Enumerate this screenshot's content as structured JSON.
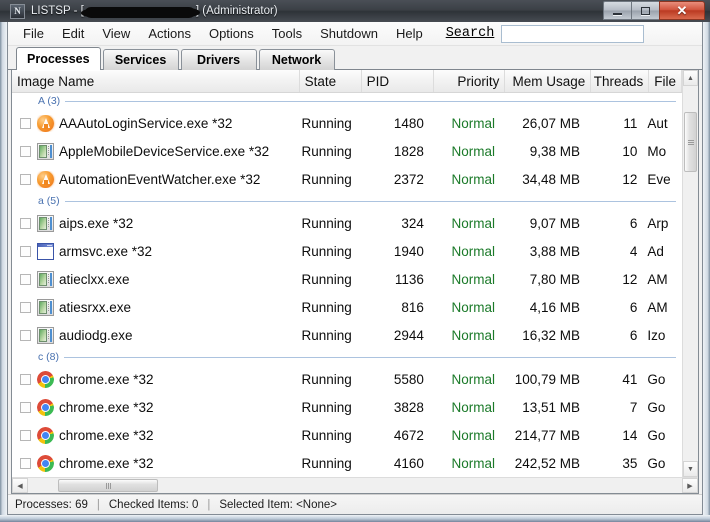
{
  "window": {
    "app_icon_glyph": "N",
    "title_prefix": "LISTSP - [",
    "title_suffix": "] (Administrator)",
    "controls": {
      "minimize": "–",
      "maximize": "□",
      "close": "✕"
    }
  },
  "menubar": {
    "items": [
      {
        "label": "File"
      },
      {
        "label": "Edit"
      },
      {
        "label": "View"
      },
      {
        "label": "Actions"
      },
      {
        "label": "Options"
      },
      {
        "label": "Tools"
      },
      {
        "label": "Shutdown"
      },
      {
        "label": "Help"
      }
    ],
    "search_label": "Search",
    "search_value": "",
    "search_placeholder": ""
  },
  "tabs": [
    {
      "label": "Processes",
      "active": true
    },
    {
      "label": "Services",
      "active": false
    },
    {
      "label": "Drivers",
      "active": false
    },
    {
      "label": "Network",
      "active": false
    }
  ],
  "columns": [
    {
      "key": "name",
      "label": "Image Name",
      "align": "left"
    },
    {
      "key": "state",
      "label": "State",
      "align": "left"
    },
    {
      "key": "pid",
      "label": "PID",
      "align": "left"
    },
    {
      "key": "priority",
      "label": "Priority",
      "align": "right"
    },
    {
      "key": "mem",
      "label": "Mem Usage",
      "align": "right"
    },
    {
      "key": "threads",
      "label": "Threads",
      "align": "right"
    },
    {
      "key": "file",
      "label": "File",
      "align": "left"
    }
  ],
  "groups": [
    {
      "label": "A (3)",
      "rows": [
        {
          "checked": false,
          "icon": "autoit-icon",
          "name": "AAAutoLoginService.exe *32",
          "state": "Running",
          "pid": "1480",
          "priority": "Normal",
          "mem": "26,07 MB",
          "threads": "11",
          "file": "Aut"
        },
        {
          "checked": false,
          "icon": "app-window-icon",
          "name": "AppleMobileDeviceService.exe *32",
          "state": "Running",
          "pid": "1828",
          "priority": "Normal",
          "mem": "9,38 MB",
          "threads": "10",
          "file": "Mo"
        },
        {
          "checked": false,
          "icon": "autoit-icon",
          "name": "AutomationEventWatcher.exe *32",
          "state": "Running",
          "pid": "2372",
          "priority": "Normal",
          "mem": "34,48 MB",
          "threads": "12",
          "file": "Eve"
        }
      ]
    },
    {
      "label": "a (5)",
      "rows": [
        {
          "checked": false,
          "icon": "app-window-icon",
          "name": "aips.exe *32",
          "state": "Running",
          "pid": "324",
          "priority": "Normal",
          "mem": "9,07 MB",
          "threads": "6",
          "file": "Arp"
        },
        {
          "checked": false,
          "icon": "blue-window-icon",
          "name": "armsvc.exe *32",
          "state": "Running",
          "pid": "1940",
          "priority": "Normal",
          "mem": "3,88 MB",
          "threads": "4",
          "file": "Ad"
        },
        {
          "checked": false,
          "icon": "app-window-icon",
          "name": "atieclxx.exe",
          "state": "Running",
          "pid": "1136",
          "priority": "Normal",
          "mem": "7,80 MB",
          "threads": "12",
          "file": "AM"
        },
        {
          "checked": false,
          "icon": "app-window-icon",
          "name": "atiesrxx.exe",
          "state": "Running",
          "pid": "816",
          "priority": "Normal",
          "mem": "4,16 MB",
          "threads": "6",
          "file": "AM"
        },
        {
          "checked": false,
          "icon": "app-window-icon",
          "name": "audiodg.exe",
          "state": "Running",
          "pid": "2944",
          "priority": "Normal",
          "mem": "16,32 MB",
          "threads": "6",
          "file": "Izo"
        }
      ]
    },
    {
      "label": "c (8)",
      "rows": [
        {
          "checked": false,
          "icon": "chrome-icon",
          "name": "chrome.exe *32",
          "state": "Running",
          "pid": "5580",
          "priority": "Normal",
          "mem": "100,79 MB",
          "threads": "41",
          "file": "Go"
        },
        {
          "checked": false,
          "icon": "chrome-icon",
          "name": "chrome.exe *32",
          "state": "Running",
          "pid": "3828",
          "priority": "Normal",
          "mem": "13,51 MB",
          "threads": "7",
          "file": "Go"
        },
        {
          "checked": false,
          "icon": "chrome-icon",
          "name": "chrome.exe *32",
          "state": "Running",
          "pid": "4672",
          "priority": "Normal",
          "mem": "214,77 MB",
          "threads": "14",
          "file": "Go"
        },
        {
          "checked": false,
          "icon": "chrome-icon",
          "name": "chrome.exe *32",
          "state": "Running",
          "pid": "4160",
          "priority": "Normal",
          "mem": "242,52 MB",
          "threads": "35",
          "file": "Go"
        }
      ]
    }
  ],
  "statusbar": {
    "processes": "Processes: 69",
    "sep1": "|",
    "checked_items": "Checked Items: 0",
    "sep2": "|",
    "selected_item": "Selected Item: <None>"
  },
  "scrollbars": {
    "v_up": "▲",
    "v_down": "▼",
    "h_left": "◀",
    "h_right": "▶"
  },
  "colors": {
    "priority_green": "#1b7a29",
    "group_blue": "#4a72b0",
    "close_red": "#bb3a22"
  }
}
